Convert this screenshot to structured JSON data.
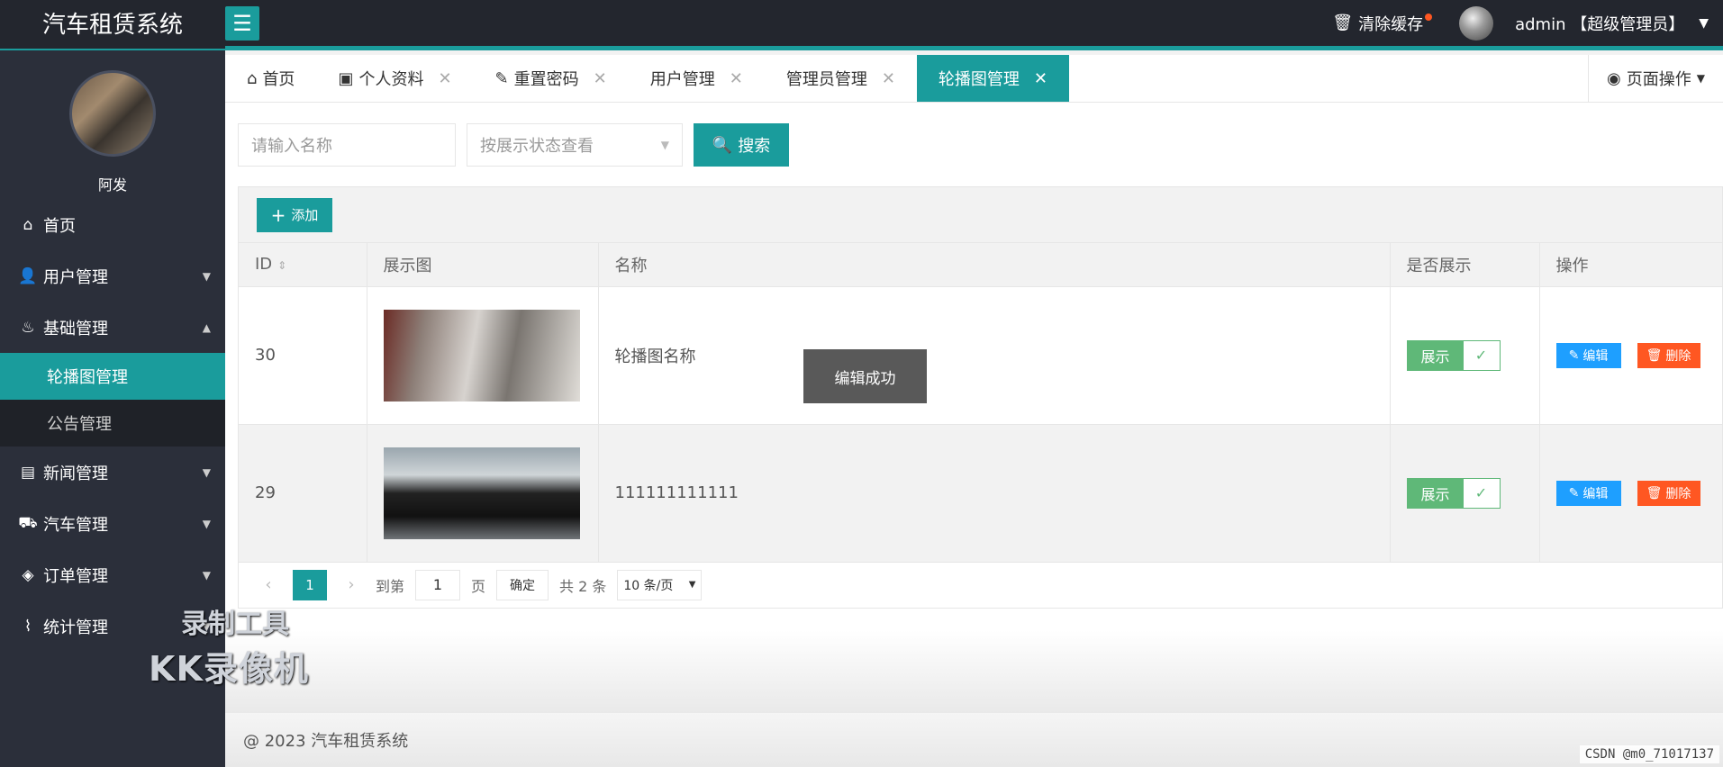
{
  "header": {
    "title": "汽车租赁系统",
    "clear_cache": "清除缓存",
    "admin": "admin 【超级管理员】"
  },
  "sidebar": {
    "profile_name": "阿发",
    "items": [
      {
        "label": "首页",
        "icon": "home-icon"
      },
      {
        "label": "用户管理",
        "icon": "user-icon"
      },
      {
        "label": "基础管理",
        "icon": "fire-icon"
      },
      {
        "label": "新闻管理",
        "icon": "news-icon"
      },
      {
        "label": "汽车管理",
        "icon": "car-icon"
      },
      {
        "label": "订单管理",
        "icon": "order-icon"
      },
      {
        "label": "统计管理",
        "icon": "stats-icon"
      }
    ],
    "sub_items": [
      "轮播图管理",
      "公告管理"
    ]
  },
  "tabs": [
    {
      "label": "首页"
    },
    {
      "label": "个人资料"
    },
    {
      "label": "重置密码"
    },
    {
      "label": "用户管理"
    },
    {
      "label": "管理员管理"
    },
    {
      "label": "轮播图管理"
    }
  ],
  "page_ops": "页面操作",
  "search": {
    "name_placeholder": "请输入名称",
    "status_placeholder": "按展示状态查看",
    "button": "搜索"
  },
  "toolbar": {
    "add": "添加"
  },
  "table": {
    "headers": [
      "ID",
      "展示图",
      "名称",
      "是否展示",
      "操作"
    ],
    "rows": [
      {
        "id": "30",
        "name": "轮播图名称",
        "status": "展示"
      },
      {
        "id": "29",
        "name": "111111111111",
        "status": "展示"
      }
    ],
    "edit": "编辑",
    "delete": "删除"
  },
  "pager": {
    "current": "1",
    "goto": "到第",
    "page_input": "1",
    "page_unit": "页",
    "confirm": "确定",
    "total": "共 2 条",
    "size": "10 条/页"
  },
  "toast": "编辑成功",
  "watermark": {
    "line1": "录制工具",
    "line2": "KK录像机"
  },
  "footer": "@ 2023 汽车租赁系统",
  "csdn": "CSDN @m0_71017137",
  "colors": {
    "primary": "#1a9c9c",
    "header": "#23262e",
    "sidebar": "#2b2f3a",
    "success": "#5fb878",
    "edit": "#1e9fff",
    "danger": "#ff5722"
  }
}
